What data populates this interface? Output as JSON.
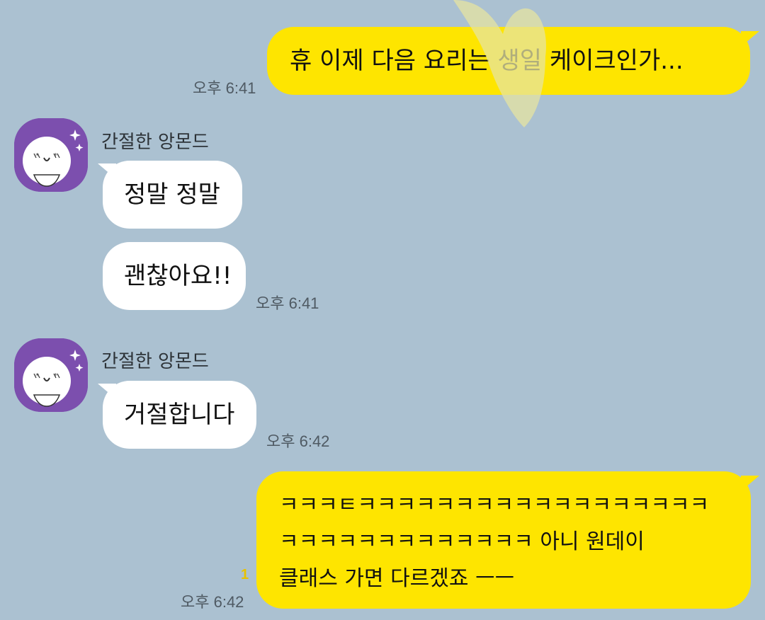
{
  "messages": [
    {
      "sender": "me",
      "text": "휴 이제 다음 요리는 생일 케이크인가...",
      "time": "오후 6:41"
    },
    {
      "sender": "간절한 앙몬드",
      "texts": [
        "정말 정말",
        "괜찮아요!!"
      ],
      "time": "오후 6:41"
    },
    {
      "sender": "간절한 앙몬드",
      "texts": [
        "거절합니다"
      ],
      "time": "오후 6:42"
    },
    {
      "sender": "me",
      "lines": [
        "ㅋㅋㅋㅌㅋㅋㅋㅋㅋㅋㅋㅋㅋㅋㅋㅋㅋㅋㅋㅋㅋㅋ",
        "ㅋㅋㅋㅋㅋㅋㅋㅋㅋㅋㅋㅋㅋ 아니 원데이",
        "클래스 가면 다르겠죠 ㅡㅡ"
      ],
      "time": "오후 6:42",
      "unread": "1"
    }
  ],
  "colors": {
    "background": "#abc1d1",
    "my_bubble": "#fee500",
    "other_bubble": "#ffffff",
    "avatar": "#7c4fae"
  }
}
